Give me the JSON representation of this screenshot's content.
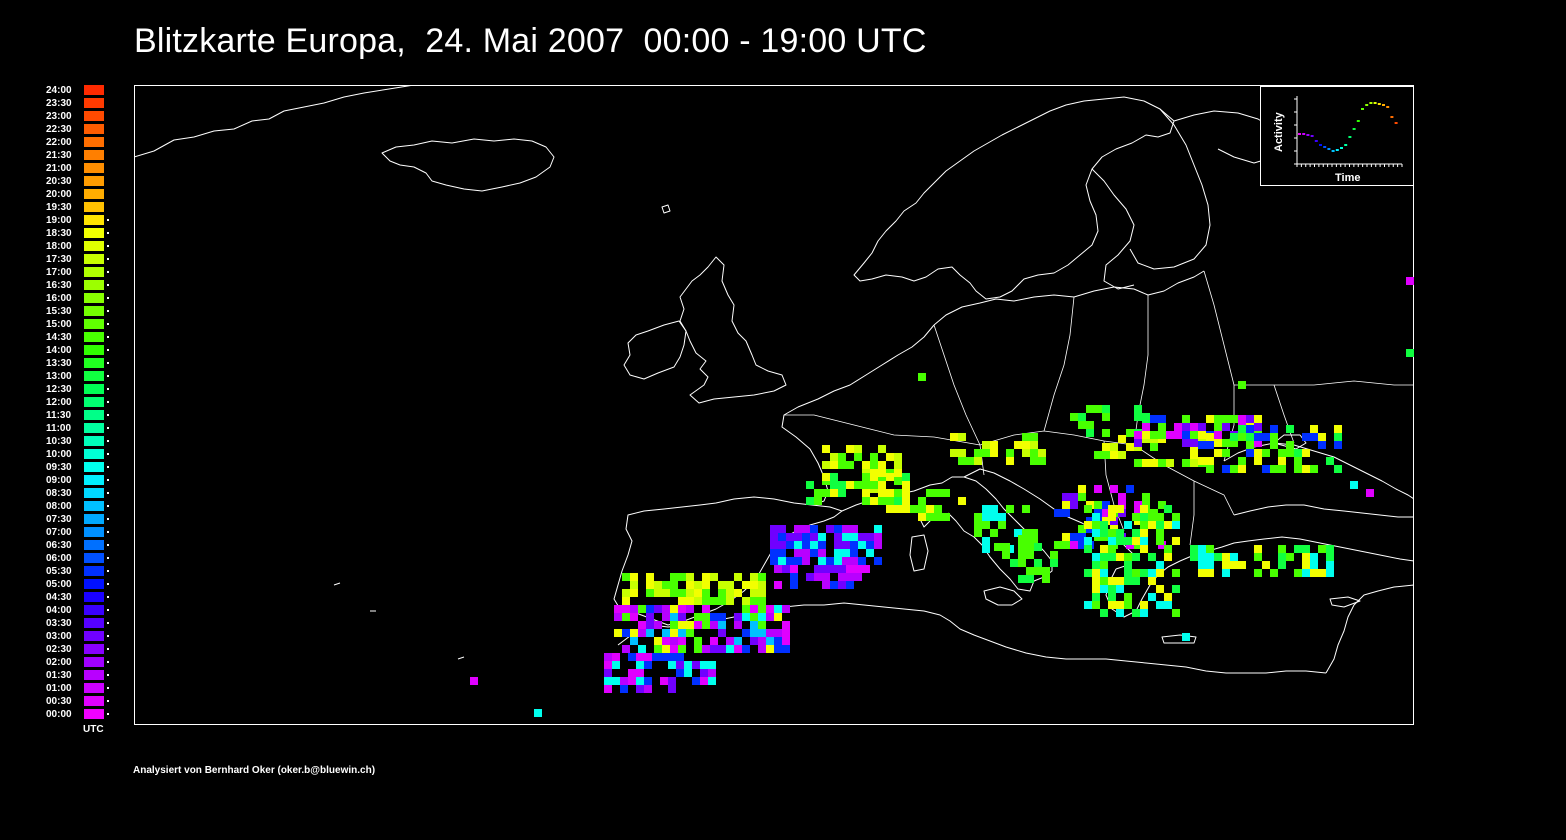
{
  "title": "Blitzkarte Europa,  24. Mai 2007  00:00 - 19:00 UTC",
  "credit": "Analysiert von Bernhard Oker (oker.b@bluewin.ch)",
  "legend": {
    "unit_label": "UTC",
    "times": [
      "24:00",
      "23:30",
      "23:00",
      "22:30",
      "22:00",
      "21:30",
      "21:00",
      "20:30",
      "20:00",
      "19:30",
      "19:00",
      "18:30",
      "18:00",
      "17:30",
      "17:00",
      "16:30",
      "16:00",
      "15:30",
      "15:00",
      "14:30",
      "14:00",
      "13:30",
      "13:00",
      "12:30",
      "12:00",
      "11:30",
      "11:00",
      "10:30",
      "10:00",
      "09:30",
      "09:00",
      "08:30",
      "08:00",
      "07:30",
      "07:00",
      "06:30",
      "06:00",
      "05:30",
      "05:00",
      "04:30",
      "04:00",
      "03:30",
      "03:00",
      "02:30",
      "02:00",
      "01:30",
      "01:00",
      "00:30",
      "00:00"
    ],
    "colors": [
      "#ff2a00",
      "#ff3a00",
      "#ff4a00",
      "#ff5c00",
      "#ff6e00",
      "#ff7f00",
      "#ff8e00",
      "#ff9c00",
      "#ffac00",
      "#ffc000",
      "#ffe400",
      "#f2ff00",
      "#e0ff00",
      "#c8ff00",
      "#b0ff00",
      "#9cff00",
      "#88ff00",
      "#74ff00",
      "#60ff00",
      "#48ff00",
      "#30ff00",
      "#20ff20",
      "#10ff40",
      "#00ff55",
      "#00ff70",
      "#00ff88",
      "#00ffa0",
      "#00ffbb",
      "#00ffd5",
      "#00ffee",
      "#00f0ff",
      "#00d8ff",
      "#00c0ff",
      "#00a8ff",
      "#0090ff",
      "#0070ff",
      "#0050ff",
      "#0030ff",
      "#0010ff",
      "#1a00ff",
      "#3a00ff",
      "#5500ff",
      "#7000ff",
      "#8800ff",
      "#a000ff",
      "#b800ff",
      "#cc00ff",
      "#e000ff",
      "#f000ff"
    ],
    "marked_from_index": 10
  },
  "inset": {
    "ylabel": "Activity",
    "xlabel": "Time"
  }
}
